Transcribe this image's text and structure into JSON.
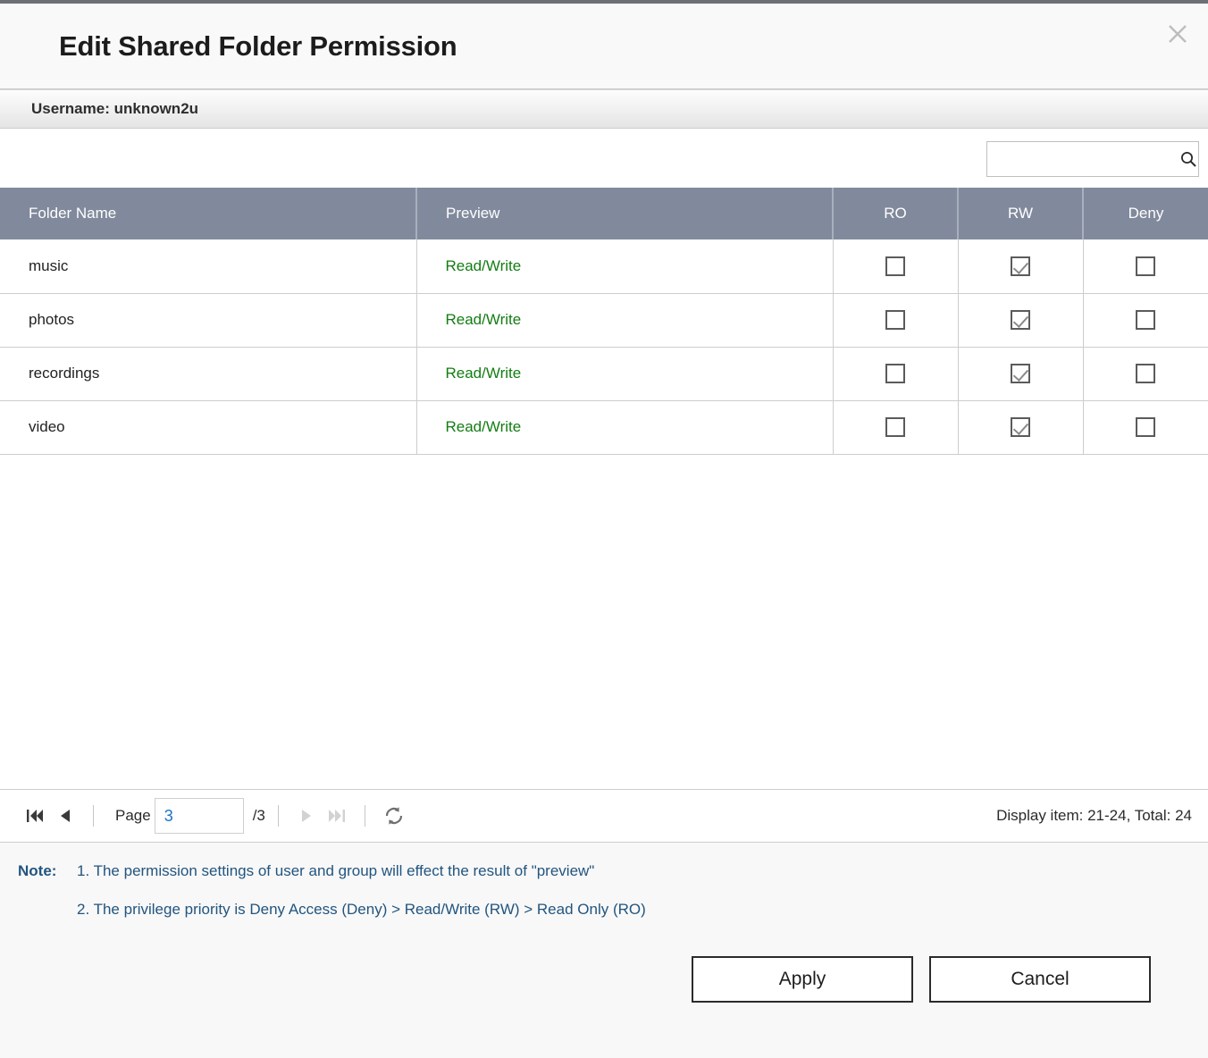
{
  "dialog": {
    "title": "Edit Shared Folder Permission",
    "close_icon": "close-icon",
    "username_label": "Username: unknown2u"
  },
  "search": {
    "value": "",
    "placeholder": "",
    "icon": "search-icon"
  },
  "table": {
    "columns": [
      "Folder Name",
      "Preview",
      "RO",
      "RW",
      "Deny"
    ],
    "rows": [
      {
        "folder": "music",
        "preview": "Read/Write",
        "ro": false,
        "rw": true,
        "deny": false
      },
      {
        "folder": "photos",
        "preview": "Read/Write",
        "ro": false,
        "rw": true,
        "deny": false
      },
      {
        "folder": "recordings",
        "preview": "Read/Write",
        "ro": false,
        "rw": true,
        "deny": false
      },
      {
        "folder": "video",
        "preview": "Read/Write",
        "ro": false,
        "rw": true,
        "deny": false
      }
    ]
  },
  "pagination": {
    "first_icon": "first-page-icon",
    "prev_icon": "prev-page-icon",
    "next_icon": "next-page-icon",
    "last_icon": "last-page-icon",
    "refresh_icon": "refresh-icon",
    "page_label": "Page",
    "page_value": "3",
    "total_pages": "/3",
    "display_item": "Display item: 21-24, Total: 24"
  },
  "notes": {
    "tag": "Note:",
    "items": [
      "1. The permission settings of user and group will effect the result of \"preview\"",
      "2. The privilege priority is Deny Access (Deny) > Read/Write (RW) > Read Only (RO)"
    ]
  },
  "footer": {
    "apply_label": "Apply",
    "cancel_label": "Cancel"
  },
  "colors": {
    "header_bar": "#818a9c",
    "preview_green": "#137d13",
    "note_blue": "#22557f",
    "page_blue": "#1a73c8"
  }
}
